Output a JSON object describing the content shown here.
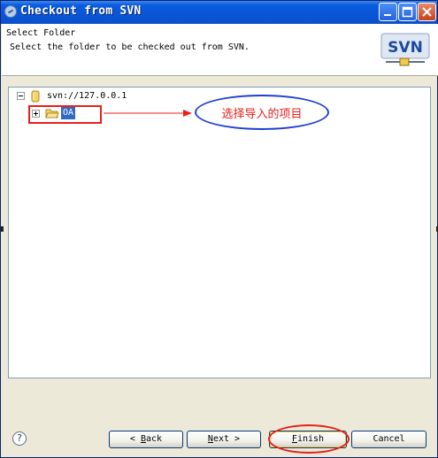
{
  "window": {
    "title": "Checkout from SVN"
  },
  "header": {
    "title": "Select Folder",
    "description": "Select the folder to be checked out from SVN.",
    "logo_text": "SVN"
  },
  "tree": {
    "root": {
      "label": "svn://127.0.0.1",
      "expanded": true
    },
    "children": [
      {
        "label": "OA",
        "selected": true,
        "expanded": false
      }
    ]
  },
  "annotation": {
    "text": "选择导入的项目"
  },
  "buttons": {
    "back_prefix": "< ",
    "back_mnemonic": "B",
    "back_rest": "ack",
    "next_mnemonic": "N",
    "next_rest": "ext",
    "next_suffix": " >",
    "finish_mnemonic": "F",
    "finish_rest": "inish",
    "cancel": "Cancel"
  },
  "help": {
    "glyph": "?"
  },
  "colors": {
    "annotation_red": "#e8201c",
    "annotation_blue": "#1f3fd6",
    "selection": "#316ac5",
    "titlebar": "#0a55d8"
  }
}
